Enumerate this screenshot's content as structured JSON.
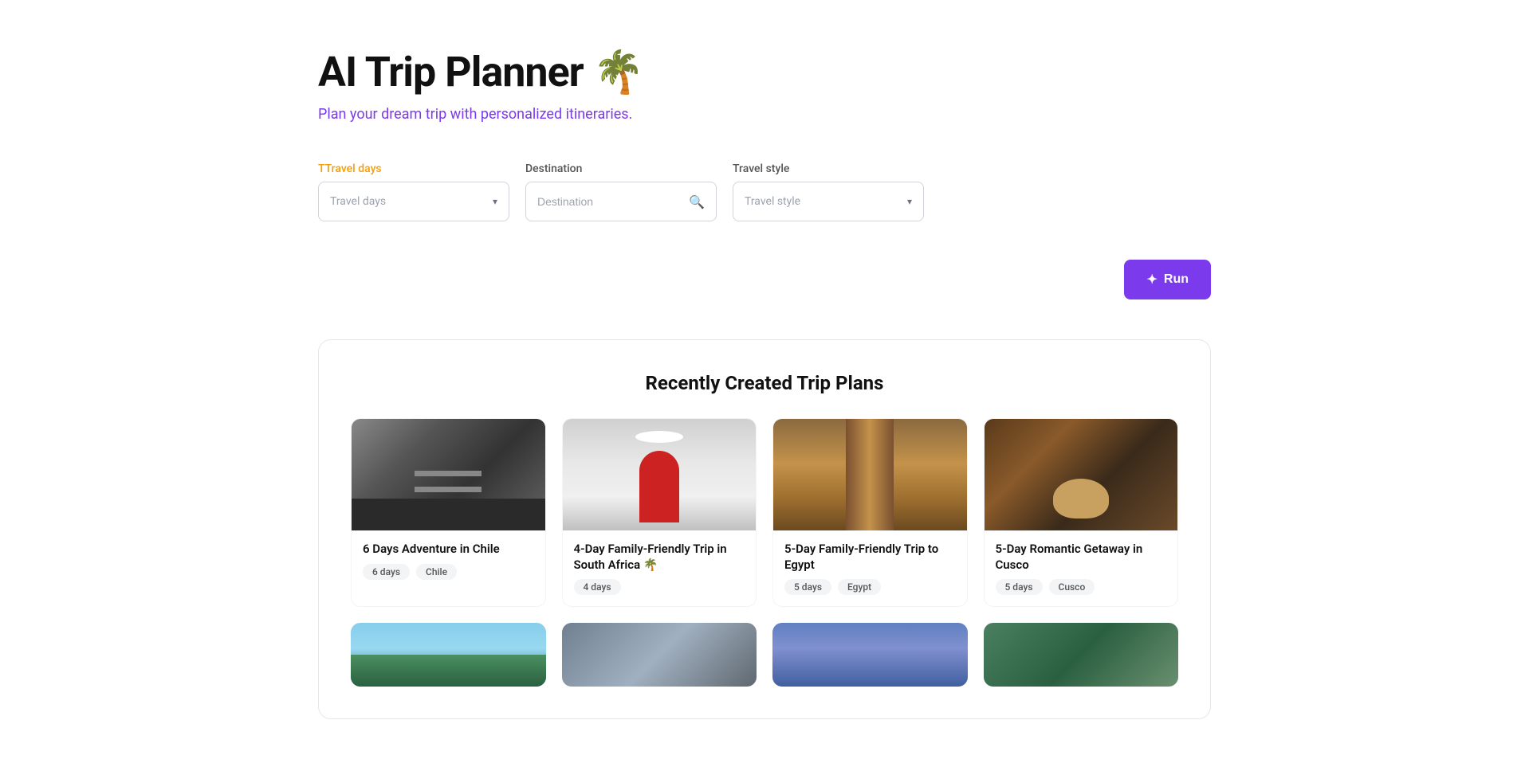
{
  "header": {
    "title": "AI Trip Planner 🌴",
    "subtitle": "Plan your dream trip with personalized itineraries."
  },
  "form": {
    "travel_days_label": "Travel days",
    "travel_days_label_highlight": "T",
    "travel_days_placeholder": "Travel days",
    "destination_label": "Destination",
    "destination_placeholder": "Destination",
    "travel_style_label": "Travel style",
    "travel_style_placeholder": "Travel style"
  },
  "run_button": {
    "label": "Run",
    "icon": "✦"
  },
  "recent_section": {
    "title": "Recently Created Trip Plans",
    "cards": [
      {
        "title": "6 Days Adventure in Chile",
        "tags": [
          "6 days",
          "Chile"
        ],
        "img_class": "card-img-1"
      },
      {
        "title": "4-Day Family-Friendly Trip in South Africa 🌴",
        "tags": [
          "4 days"
        ],
        "img_class": "card-img-2"
      },
      {
        "title": "5-Day Family-Friendly Trip to Egypt",
        "tags": [
          "5 days",
          "Egypt"
        ],
        "img_class": "card-img-3"
      },
      {
        "title": "5-Day Romantic Getaway in Cusco",
        "tags": [
          "5 days",
          "Cusco"
        ],
        "img_class": "card-img-4"
      }
    ],
    "bottom_cards": [
      {
        "img_class": "card-img-5"
      },
      {
        "img_class": "card-img-6"
      },
      {
        "img_class": "card-img-7"
      },
      {
        "img_class": "card-img-8"
      }
    ]
  }
}
